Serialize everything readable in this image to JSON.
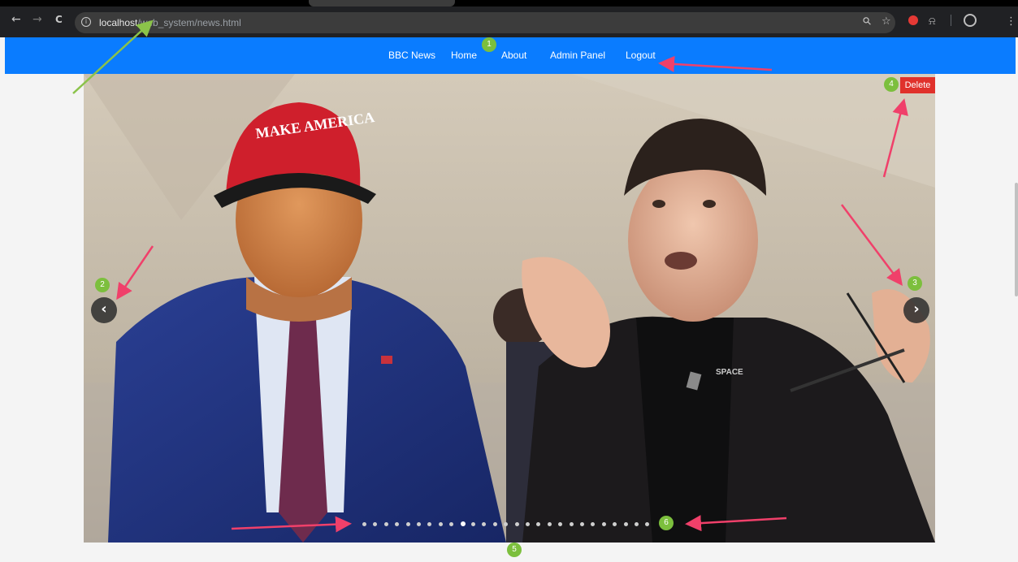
{
  "browser": {
    "back_icon": "←",
    "forward_icon": "→",
    "reload_icon": "C",
    "info_icon": "i",
    "url_host": "localhost",
    "url_path": "/web_system/news.html",
    "zoom_icon": "⚲",
    "star_icon": "☆",
    "extension_icon": "⍾",
    "menu_icon": "⋮"
  },
  "navbar": {
    "links": [
      {
        "label": "BBC News"
      },
      {
        "label": "Home"
      },
      {
        "label": "About"
      },
      {
        "label": "Admin Panel"
      },
      {
        "label": "Logout"
      }
    ]
  },
  "carousel": {
    "delete_label": "Delete",
    "prev_glyph": "‹",
    "next_glyph": "›",
    "indicator_count": 27,
    "active_indicator": 9,
    "cap_text": "MAKE AMERICA",
    "shirt_text": "SPACE"
  },
  "annotations": {
    "badges": [
      "1",
      "2",
      "3",
      "4",
      "5",
      "6"
    ],
    "arrow_green": "#8bc34a",
    "arrow_red": "#f0406a",
    "badge_color": "#7cbf3d"
  },
  "colors": {
    "navbar": "#0a7cff",
    "delete": "#e0312b",
    "chrome": "#202124"
  }
}
